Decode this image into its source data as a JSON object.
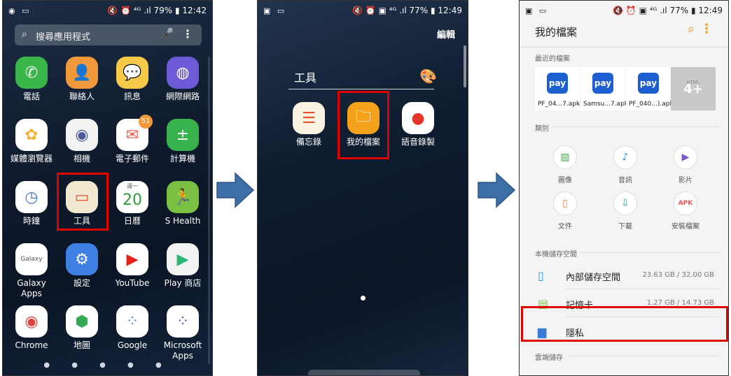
{
  "colors": {
    "highlight": "#e00000",
    "arrow": "#3e6ea8",
    "accent": "#f0a020",
    "pay": "#1d5fd1"
  },
  "screen1": {
    "status": {
      "left": "◉ ▭",
      "right": "🔇 ⏰ ⁴ᴳ .ıl 79% ▮ 12:42"
    },
    "search": {
      "placeholder": "搜尋應用程式"
    },
    "apps": [
      {
        "label": "電話",
        "icon": "phone-icon",
        "bg": "#3ab54a",
        "glyph": "✆"
      },
      {
        "label": "聯絡人",
        "icon": "contacts-icon",
        "bg": "#f29a3b",
        "glyph": "👤"
      },
      {
        "label": "訊息",
        "icon": "messages-icon",
        "bg": "#f7c948",
        "glyph": "💬"
      },
      {
        "label": "網際網路",
        "icon": "internet-icon",
        "bg": "#6c5ad6",
        "glyph": "◍"
      },
      {
        "label": "媒體瀏覽器",
        "icon": "media-browser-icon",
        "bg": "#ffffff",
        "glyph": "✿",
        "fg": "#f2b233"
      },
      {
        "label": "相機",
        "icon": "camera-icon",
        "bg": "#f3f3f3",
        "glyph": "◉",
        "fg": "#4a5a9a"
      },
      {
        "label": "電子郵件",
        "icon": "email-icon",
        "bg": "#ffffff",
        "glyph": "✉",
        "fg": "#ea5b4a",
        "badge": "51"
      },
      {
        "label": "計算機",
        "icon": "calculator-icon",
        "bg": "#37b24d",
        "glyph": "±"
      },
      {
        "label": "時鐘",
        "icon": "clock-icon",
        "bg": "#ffffff",
        "glyph": "◷",
        "fg": "#4a73c8"
      },
      {
        "label": "工具",
        "icon": "tools-folder-icon",
        "bg": "#f1ead1",
        "glyph": "▭",
        "fg": "#e5522f"
      },
      {
        "label": "日曆",
        "icon": "calendar-icon",
        "bg": "#ffffff",
        "glyph": "20",
        "fg": "#2e9c3e",
        "sub": "週一"
      },
      {
        "label": "S Health",
        "icon": "shealth-icon",
        "bg": "#7ac143",
        "glyph": "🏃"
      },
      {
        "label": "Galaxy Apps",
        "icon": "galaxy-apps-icon",
        "bg": "#ffffff",
        "glyph": "Galaxy",
        "fg": "#555555"
      },
      {
        "label": "設定",
        "icon": "settings-icon",
        "bg": "#3d7fe2",
        "glyph": "⚙"
      },
      {
        "label": "YouTube",
        "icon": "youtube-icon",
        "bg": "#ffffff",
        "glyph": "▶",
        "fg": "#e62117"
      },
      {
        "label": "Play 商店",
        "icon": "play-store-icon",
        "bg": "#f3f3f3",
        "glyph": "▶",
        "fg": "#2bb673"
      },
      {
        "label": "Chrome",
        "icon": "chrome-icon",
        "bg": "#ffffff",
        "glyph": "◉",
        "fg": "#db4437"
      },
      {
        "label": "地圖",
        "icon": "maps-icon",
        "bg": "#ffffff",
        "glyph": "⬢",
        "fg": "#34a853"
      },
      {
        "label": "Google",
        "icon": "google-folder-icon",
        "bg": "#ffffff",
        "glyph": "⁘",
        "fg": "#4285f4"
      },
      {
        "label": "Microsoft Apps",
        "icon": "microsoft-folder-icon",
        "bg": "#ffffff",
        "glyph": "⁘",
        "fg": "#7b3fc4"
      }
    ],
    "pager": "● ● ● ● ●"
  },
  "screen2": {
    "status": {
      "left": "▣ ▭",
      "right": "🔇 ⏰ ▣ ⁴ᴳ .ıl 77% ▮ 12:49"
    },
    "edit": "編輯",
    "folder_title": "工具",
    "apps": [
      {
        "label": "備忘錄",
        "icon": "memo-icon",
        "bg": "#fbf3e2",
        "glyph": "☰",
        "fg": "#e5522f"
      },
      {
        "label": "我的檔案",
        "icon": "my-files-icon",
        "bg": "#f4a21c",
        "glyph": "🗀",
        "fg": "#ffffff"
      },
      {
        "label": "語音錄製",
        "icon": "voice-recorder-icon",
        "bg": "#ffffff",
        "glyph": "●",
        "fg": "#e5352b"
      }
    ]
  },
  "screen3": {
    "status": {
      "left": "▣ ▭",
      "right": "🔇 ⏰ ▣ ⁴ᴳ .ıl 77% ▮ 12:49"
    },
    "title": "我的檔案",
    "recent_label": "最近的檔案",
    "recent": [
      {
        "caption": "PF_04...7.apk",
        "badge": "pay"
      },
      {
        "caption": "Samsu...7.apk",
        "badge": "pay"
      },
      {
        "caption": "PF_040...).apk",
        "badge": "pay"
      }
    ],
    "recent_more": {
      "tag": "HTML",
      "count": "4+"
    },
    "category_label": "類別",
    "categories": [
      {
        "label": "圖像",
        "icon": "image-icon",
        "glyph": "▨",
        "fg": "#4caf50"
      },
      {
        "label": "音訊",
        "icon": "audio-icon",
        "glyph": "♪",
        "fg": "#2196f3"
      },
      {
        "label": "影片",
        "icon": "video-icon",
        "glyph": "▶",
        "fg": "#7e57c2"
      },
      {
        "label": "文件",
        "icon": "document-icon",
        "glyph": "▯",
        "fg": "#ff7043"
      },
      {
        "label": "下載",
        "icon": "download-icon",
        "glyph": "⇩",
        "fg": "#26a69a"
      },
      {
        "label": "安裝檔案",
        "icon": "apk-icon",
        "glyph": "APK",
        "fg": "#ef5350"
      }
    ],
    "storage_label": "本機儲存空間",
    "storage": [
      {
        "name": "內部儲存空間",
        "size": "23.63 GB / 32.00 GB",
        "icon": "phone-storage-icon",
        "glyph": "▯",
        "fg": "#2196f3"
      },
      {
        "name": "記憶卡",
        "size": "1.27 GB / 14.73 GB",
        "icon": "sd-card-icon",
        "glyph": "▤",
        "fg": "#8bc34a"
      },
      {
        "name": "隱私",
        "size": "",
        "icon": "private-folder-icon",
        "glyph": "▆",
        "fg": "#3a7bd5"
      }
    ],
    "cloud_label": "雲端儲存"
  }
}
